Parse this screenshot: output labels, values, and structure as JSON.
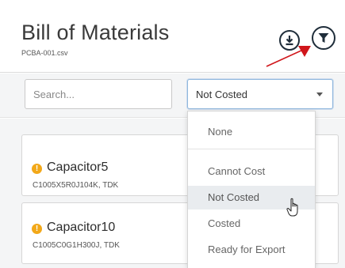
{
  "header": {
    "title": "Bill of Materials",
    "subtitle": "PCBA-001.csv",
    "download_icon": "download-arrow-icon",
    "filter_icon": "funnel-filter-icon"
  },
  "annotation": {
    "color": "#d0161b"
  },
  "toolbar": {
    "search_placeholder": "Search...",
    "search_value": "",
    "status_select_value": "Not Costed"
  },
  "cards": [
    {
      "name": "Capacitor5",
      "detail": "C1005X5R0J104K, TDK",
      "status_icon": "warning-icon"
    },
    {
      "name": "Capacitor10",
      "detail": "C1005C0G1H300J, TDK",
      "status_icon": "warning-icon"
    }
  ],
  "dropdown": {
    "options": [
      "None",
      "Cannot Cost",
      "Not Costed",
      "Costed",
      "Ready for Export"
    ],
    "hovered": "Not Costed"
  },
  "colors": {
    "warning": "#f2a819",
    "icon_dark": "#1f2d3a",
    "focus_border": "#8fb7dd",
    "hover_bg": "#e9ecef"
  }
}
